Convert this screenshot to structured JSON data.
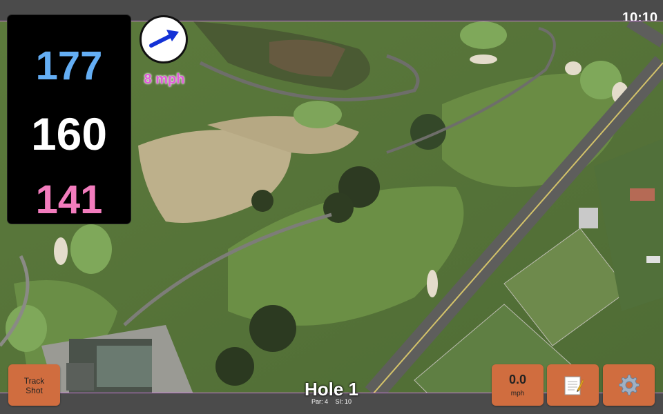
{
  "status": {
    "time": "10:10"
  },
  "distances": {
    "back": "177",
    "center": "160",
    "front": "141"
  },
  "wind": {
    "speed_label": "8 mph",
    "direction_icon": "wind-arrow-icon"
  },
  "buttons": {
    "track_line1": "Track",
    "track_line2": "Shot",
    "wind_value": "0.0",
    "wind_unit": "mph",
    "notes_icon": "notepad-icon",
    "settings_icon": "gear-icon"
  },
  "hole": {
    "title": "Hole 1",
    "par": "Par: 4",
    "si": "SI: 10"
  },
  "colors": {
    "back": "#64aef4",
    "center": "#ffffff",
    "front": "#f27cbd",
    "wind_text": "#e05bd9",
    "button": "#d06d3f"
  }
}
